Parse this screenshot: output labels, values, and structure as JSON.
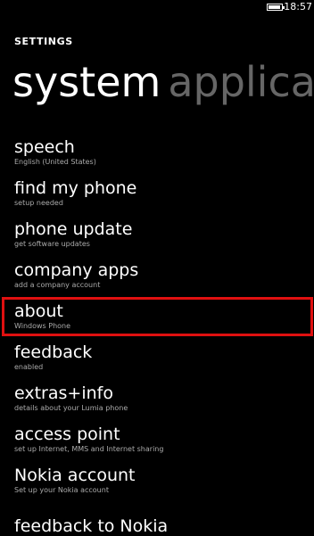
{
  "status": {
    "time": "18:57"
  },
  "header": {
    "section_title": "SETTINGS",
    "pivot_active": "system",
    "pivot_next": "applica"
  },
  "menu": [
    {
      "title": "speech",
      "subtitle": "English (United States)"
    },
    {
      "title": "find my phone",
      "subtitle": "setup needed"
    },
    {
      "title": "phone update",
      "subtitle": "get software updates"
    },
    {
      "title": "company apps",
      "subtitle": "add a company account"
    },
    {
      "title": "about",
      "subtitle": "Windows Phone"
    },
    {
      "title": "feedback",
      "subtitle": "enabled"
    },
    {
      "title": "extras+info",
      "subtitle": "details about your Lumia phone"
    },
    {
      "title": "access point",
      "subtitle": "set up Internet, MMS and Internet sharing"
    },
    {
      "title": "Nokia account",
      "subtitle": "Set up your Nokia account"
    }
  ],
  "partial_item": "feedback to Nokia",
  "colors": {
    "background": "#000000",
    "highlight": "#e01010",
    "inactive_pivot": "#666666"
  }
}
